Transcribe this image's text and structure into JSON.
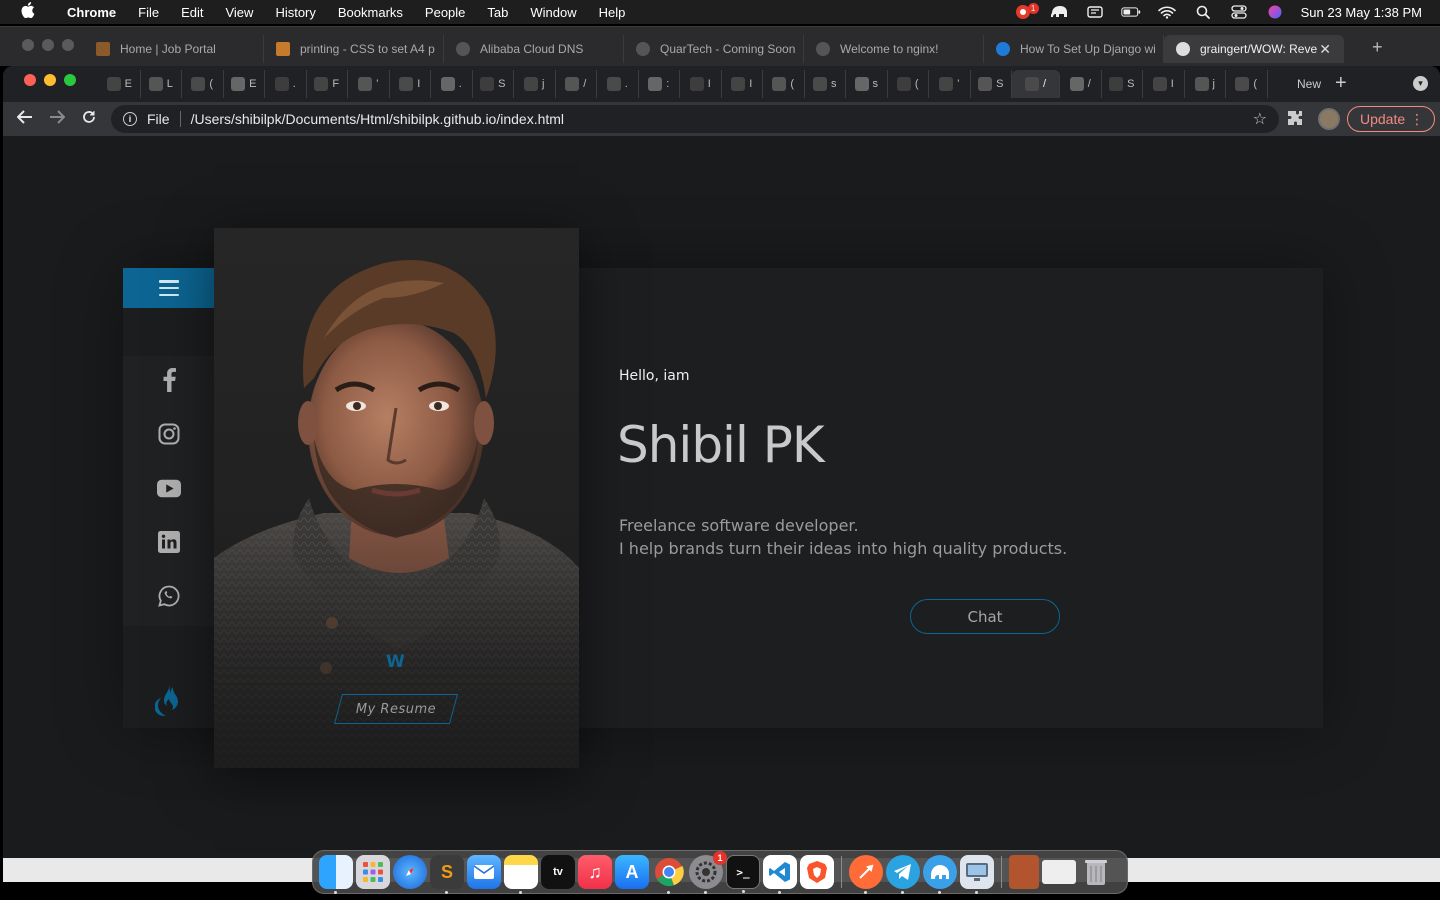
{
  "menubar": {
    "app_name": "Chrome",
    "items": [
      "File",
      "Edit",
      "View",
      "History",
      "Bookmarks",
      "People",
      "Tab",
      "Window",
      "Help"
    ],
    "clock": "Sun 23 May  1:38 PM"
  },
  "back_window": {
    "tabs": [
      {
        "title": "Home | Job Portal"
      },
      {
        "title": "printing - CSS to set A4 p"
      },
      {
        "title": "Alibaba Cloud DNS"
      },
      {
        "title": "QuarTech - Coming Soon"
      },
      {
        "title": "Welcome to nginx!"
      },
      {
        "title": "How To Set Up Django wi"
      },
      {
        "title": "graingert/WOW: Reve"
      }
    ]
  },
  "main_window": {
    "mini_tabs": [
      "E",
      "L",
      "(",
      "E",
      ".",
      "F",
      "'",
      "I",
      ".",
      "S",
      "j",
      "/",
      ".",
      ":",
      "I",
      "I",
      "(",
      "s",
      "s",
      "(",
      "'",
      "S",
      "/",
      "/",
      "S",
      "I",
      "j",
      "("
    ],
    "new_tab_label": "New",
    "address": {
      "scheme_label": "File",
      "url": "/Users/shibilpk/Documents/Html/shibilpk.github.io/index.html"
    },
    "update_label": "Update"
  },
  "page": {
    "hello": "Hello, iam",
    "name": "Shibil PK",
    "tagline_line1": "Freelance software developer.",
    "tagline_line2": "I help brands turn their ideas into high quality products.",
    "chat_label": "Chat",
    "resume_label": "My Resume",
    "logo_mark": "W",
    "social": [
      "facebook",
      "instagram",
      "youtube",
      "linkedin",
      "whatsapp"
    ],
    "accent_color": "#0c6592"
  },
  "dock": {
    "apps": [
      "Finder",
      "Launchpad",
      "Safari",
      "Sublime Text",
      "Mail",
      "Notes",
      "Apple TV",
      "Music",
      "App Store",
      "Google Chrome",
      "System Preferences",
      "Terminal",
      "Visual Studio Code",
      "Brave",
      "Postman",
      "Telegram",
      "Bitwarden",
      "Remote Desktop"
    ],
    "system_prefs_badge": "1",
    "chrome_menubar_badge": "1"
  }
}
